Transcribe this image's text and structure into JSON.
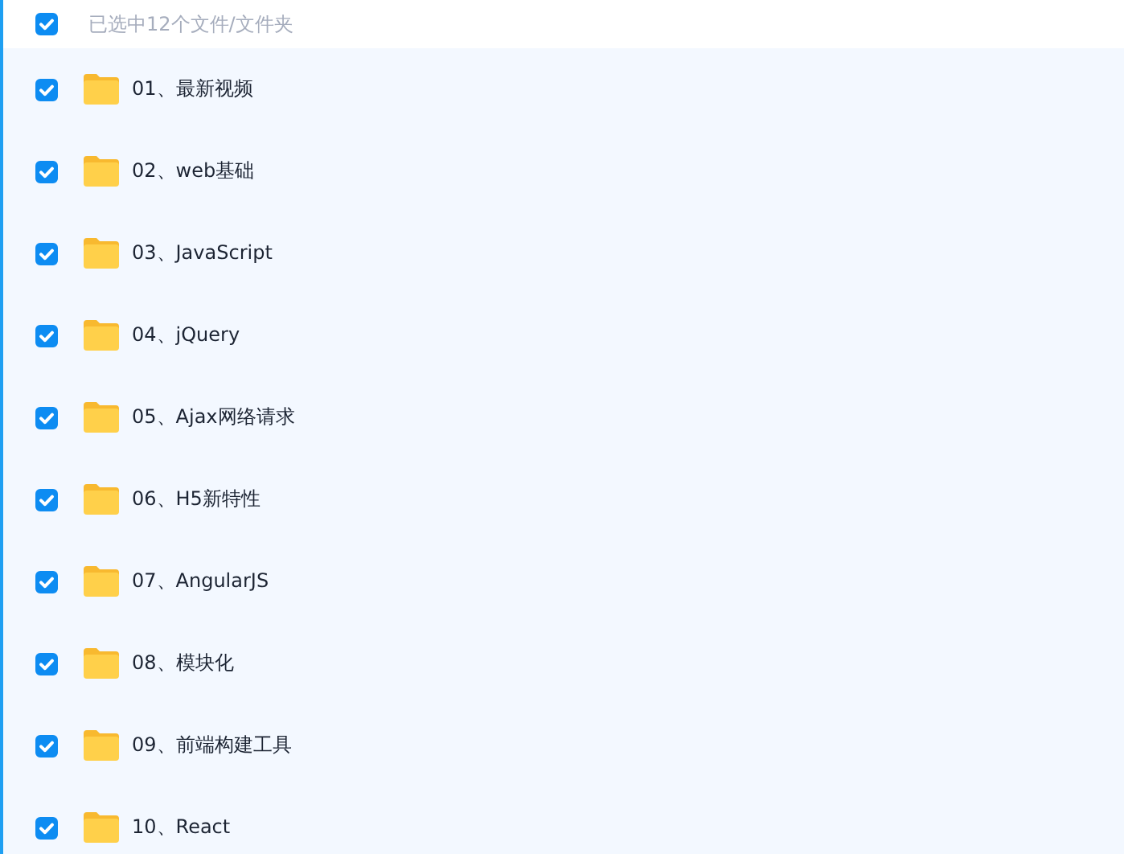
{
  "header": {
    "checked": true,
    "label": "已选中12个文件/文件夹"
  },
  "files": [
    {
      "name": "01、最新视频",
      "checked": true
    },
    {
      "name": "02、web基础",
      "checked": true
    },
    {
      "name": "03、JavaScript",
      "checked": true
    },
    {
      "name": "04、jQuery",
      "checked": true
    },
    {
      "name": "05、Ajax网络请求",
      "checked": true
    },
    {
      "name": "06、H5新特性",
      "checked": true
    },
    {
      "name": "07、AngularJS",
      "checked": true
    },
    {
      "name": "08、模块化",
      "checked": true
    },
    {
      "name": "09、前端构建工具",
      "checked": true
    },
    {
      "name": "10、React",
      "checked": true
    }
  ]
}
